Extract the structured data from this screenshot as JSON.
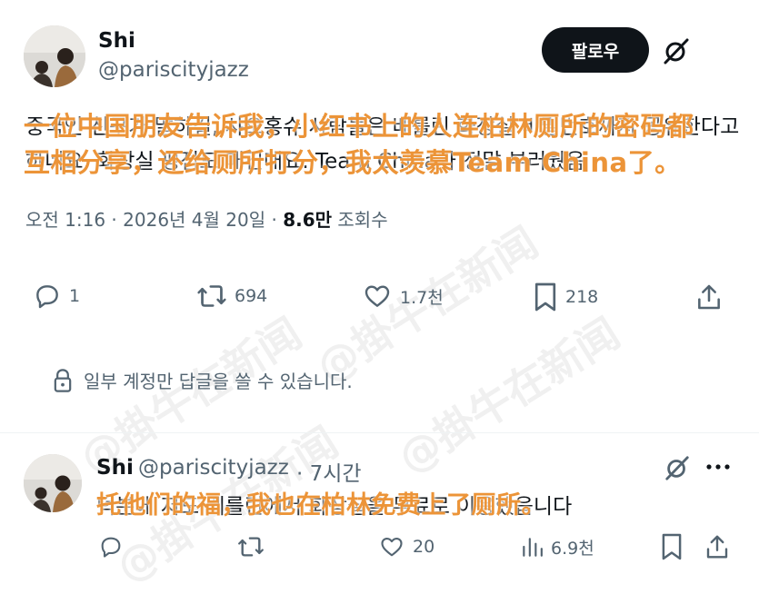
{
  "post": {
    "author_name": "Shi",
    "author_handle": "@pariscityjazz",
    "follow_label": "팔로우",
    "korean_line1": "중국인 친구가 말하길, 샤오홍슈 사람들은 베를린 화장실 비밀번호까지 공유한다고",
    "korean_line2": "하네요. 화장실 평점도 매긴대요. Team China가 정말 부러웠음",
    "caption_line1": "一位中国朋友告诉我，小红书上的人连柏林厕所的密码都",
    "caption_line2": "互相分享，还给厕所打分，我太羡慕Team China了。",
    "timestamp": "오전 1:16 · 2026년 4월 20일 · ",
    "views_count": "8.6만",
    "views_label": " 조회수",
    "actions": {
      "replies": "1",
      "reposts": "694",
      "likes": "1.7천",
      "bookmarks": "218"
    },
    "reply_restriction": "일부 계정만 답글을 쓸 수 있습니다."
  },
  "reply": {
    "author_name": "Shi",
    "author_handle": "@pariscityjazz",
    "time_ago": "· 7시간",
    "korean_text": "덕분에 저도 베를린에서 화장실을 무료로 이용했읍니다",
    "caption": "托他们的福，我也在柏林免费上了厕所。",
    "actions": {
      "likes": "20",
      "views": "6.9천"
    }
  },
  "watermark_text": "@掛牛在新闻",
  "colors": {
    "caption": "#ec9438",
    "text_primary": "#0f1419",
    "text_secondary": "#536471",
    "follow_bg": "#0f1419"
  }
}
